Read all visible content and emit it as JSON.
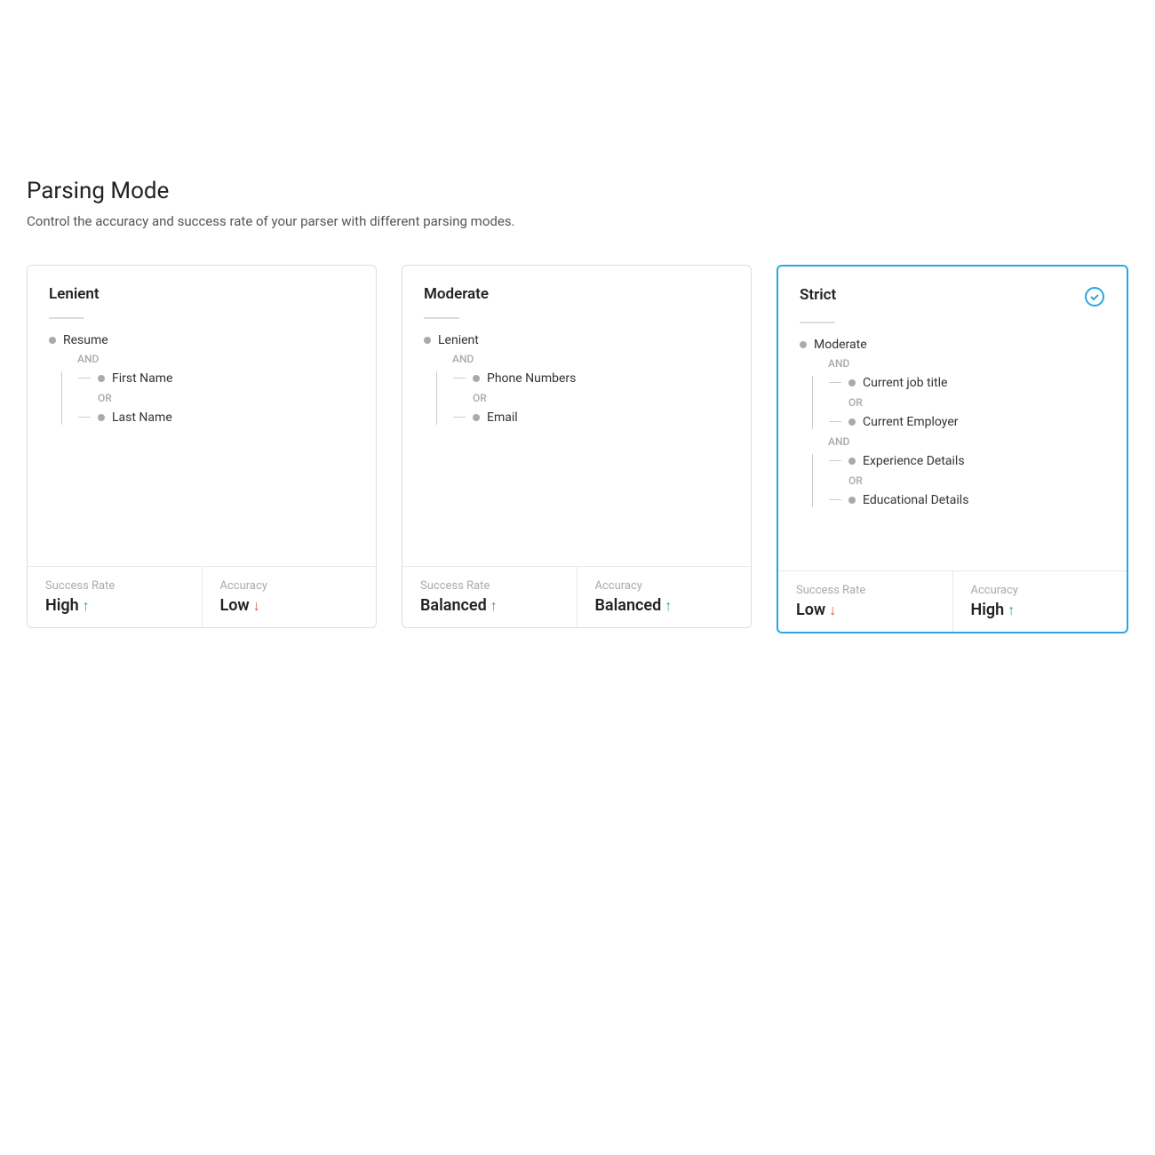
{
  "page": {
    "title": "Parsing Mode",
    "subtitle": "Control the accuracy and success rate of your parser with different parsing modes."
  },
  "cards": [
    {
      "id": "lenient",
      "title": "Lenient",
      "selected": false,
      "tree": [
        {
          "type": "item",
          "label": "Resume",
          "indent": 0
        },
        {
          "type": "logic",
          "label": "AND"
        },
        {
          "type": "block",
          "items": [
            {
              "label": "First Name"
            },
            {
              "logic": "OR"
            },
            {
              "label": "Last Name"
            }
          ]
        }
      ],
      "footer": [
        {
          "label": "Success Rate",
          "value": "High",
          "direction": "up"
        },
        {
          "label": "Accuracy",
          "value": "Low",
          "direction": "down"
        }
      ]
    },
    {
      "id": "moderate",
      "title": "Moderate",
      "selected": false,
      "tree": [
        {
          "type": "item",
          "label": "Lenient",
          "indent": 0
        },
        {
          "type": "logic",
          "label": "AND"
        },
        {
          "type": "block",
          "items": [
            {
              "label": "Phone Numbers"
            },
            {
              "logic": "OR"
            },
            {
              "label": "Email"
            }
          ]
        }
      ],
      "footer": [
        {
          "label": "Success Rate",
          "value": "Balanced",
          "direction": "up"
        },
        {
          "label": "Accuracy",
          "value": "Balanced",
          "direction": "up"
        }
      ]
    },
    {
      "id": "strict",
      "title": "Strict",
      "selected": true,
      "tree": [
        {
          "type": "item",
          "label": "Moderate",
          "indent": 0
        },
        {
          "type": "logic",
          "label": "AND"
        },
        {
          "type": "block",
          "items": [
            {
              "label": "Current job title"
            },
            {
              "logic": "OR"
            },
            {
              "label": "Current Employer"
            }
          ]
        },
        {
          "type": "logic",
          "label": "AND"
        },
        {
          "type": "block",
          "items": [
            {
              "label": "Experience Details"
            },
            {
              "logic": "OR"
            },
            {
              "label": "Educational Details"
            }
          ]
        }
      ],
      "footer": [
        {
          "label": "Success Rate",
          "value": "Low",
          "direction": "down"
        },
        {
          "label": "Accuracy",
          "value": "High",
          "direction": "up"
        }
      ]
    }
  ]
}
